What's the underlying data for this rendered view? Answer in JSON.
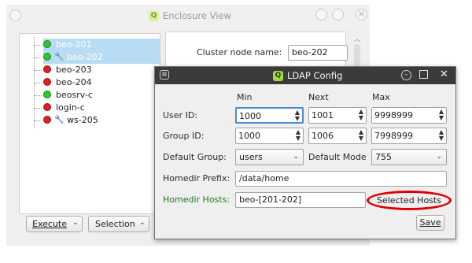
{
  "enclosure_window": {
    "title": "Enclosure View",
    "tree": [
      {
        "label": "beo-201",
        "status": "green",
        "selected": true,
        "tool": ""
      },
      {
        "label": "beo-202",
        "status": "green",
        "selected": true,
        "tool": "red-wrench"
      },
      {
        "label": "beo-203",
        "status": "red",
        "selected": false,
        "tool": ""
      },
      {
        "label": "beo-204",
        "status": "red",
        "selected": false,
        "tool": ""
      },
      {
        "label": "beosrv-c",
        "status": "green",
        "selected": false,
        "tool": ""
      },
      {
        "label": "login-c",
        "status": "red",
        "selected": false,
        "tool": ""
      },
      {
        "label": "ws-205",
        "status": "red",
        "selected": false,
        "tool": "blue-wrench"
      }
    ],
    "execute_button": "Execute",
    "selection_button": "Selection",
    "cluster_node_label": "Cluster node name:",
    "cluster_node_value": "beo-202"
  },
  "ldap_dialog": {
    "title": "LDAP Config",
    "col_headers": {
      "min": "Min",
      "next": "Next",
      "max": "Max"
    },
    "user_id_label": "User ID:",
    "user_id": {
      "min": "1000",
      "next": "1001",
      "max": "9998999"
    },
    "group_id_label": "Group ID:",
    "group_id": {
      "min": "1000",
      "next": "1006",
      "max": "7998999"
    },
    "default_group_label": "Default Group:",
    "default_group_value": "users",
    "default_mode_label": "Default Mode",
    "default_mode_value": "755",
    "homedir_prefix_label": "Homedir Prefix:",
    "homedir_prefix_value": "/data/home",
    "homedir_hosts_label": "Homedir Hosts:",
    "homedir_hosts_value": "beo-[201-202]",
    "selected_hosts_button": "Selected Hosts",
    "save_button": "Save"
  },
  "colors": {
    "status_green": "#2ec72e",
    "status_red": "#e02020",
    "selection_bg": "#b9dcf5",
    "dialog_titlebar": "#3b3b3b",
    "homedir_hosts_label": "#1f7a1f",
    "highlight_ellipse": "#e00000",
    "logo_bg": "#9fdc3c"
  },
  "icons": [
    "minimize-icon",
    "maximize-icon",
    "close-icon",
    "menu-icon",
    "q-logo-icon",
    "wrench-icon",
    "chevron-down-icon",
    "spin-arrows-icon"
  ]
}
